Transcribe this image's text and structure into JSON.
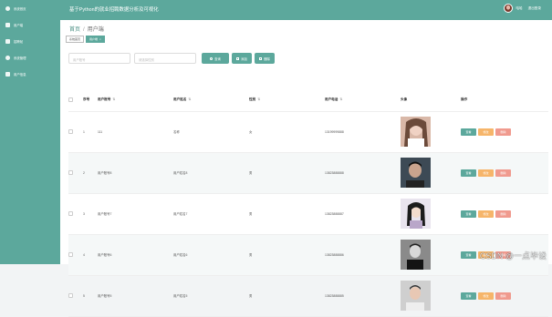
{
  "header": {
    "title": "基于Python的就业招聘数据分析及可视化",
    "user_name": "哈哈",
    "logout": "退出登录"
  },
  "sidebar": {
    "items": [
      {
        "label": "系统首页",
        "icon": "home-icon"
      },
      {
        "label": "用户端",
        "icon": "user-icon"
      },
      {
        "label": "招聘帖",
        "icon": "document-icon"
      },
      {
        "label": "系统管理",
        "icon": "settings-icon"
      },
      {
        "label": "用户信息",
        "icon": "profile-icon"
      }
    ]
  },
  "breadcrumb": {
    "home": "首页",
    "separator": "/",
    "current": "用户端"
  },
  "tags": [
    {
      "label": "系统首页",
      "active": false
    },
    {
      "label": "用户端",
      "active": true,
      "close": "×"
    }
  ],
  "search": {
    "account_placeholder": "用户账号",
    "select_placeholder": "请选择性别",
    "search_label": "查询",
    "add_label": "添加",
    "delete_label": "删除"
  },
  "table": {
    "columns": [
      "",
      "序号",
      "用户账号",
      "用户姓名",
      "性别",
      "用户电话",
      "头像",
      "操作"
    ],
    "rows": [
      {
        "index": "1",
        "account": "111",
        "name": "名称",
        "gender": "女",
        "phone": "13199999888"
      },
      {
        "index": "2",
        "account": "用户账号8",
        "name": "用户姓名8",
        "gender": "男",
        "phone": "13823888888"
      },
      {
        "index": "3",
        "account": "用户账号7",
        "name": "用户姓名7",
        "gender": "男",
        "phone": "13823888887"
      },
      {
        "index": "4",
        "account": "用户账号6",
        "name": "用户姓名6",
        "gender": "男",
        "phone": "13823888886"
      },
      {
        "index": "5",
        "account": "用户账号5",
        "name": "用户姓名5",
        "gender": "男",
        "phone": "13823888885"
      }
    ],
    "actions": {
      "view": "查看",
      "edit": "修改",
      "delete": "删除"
    }
  },
  "watermark": "CSDN @一点毕设",
  "colors": {
    "primary": "#5ca89c",
    "edit": "#f6b56a",
    "delete": "#f09a8e"
  }
}
